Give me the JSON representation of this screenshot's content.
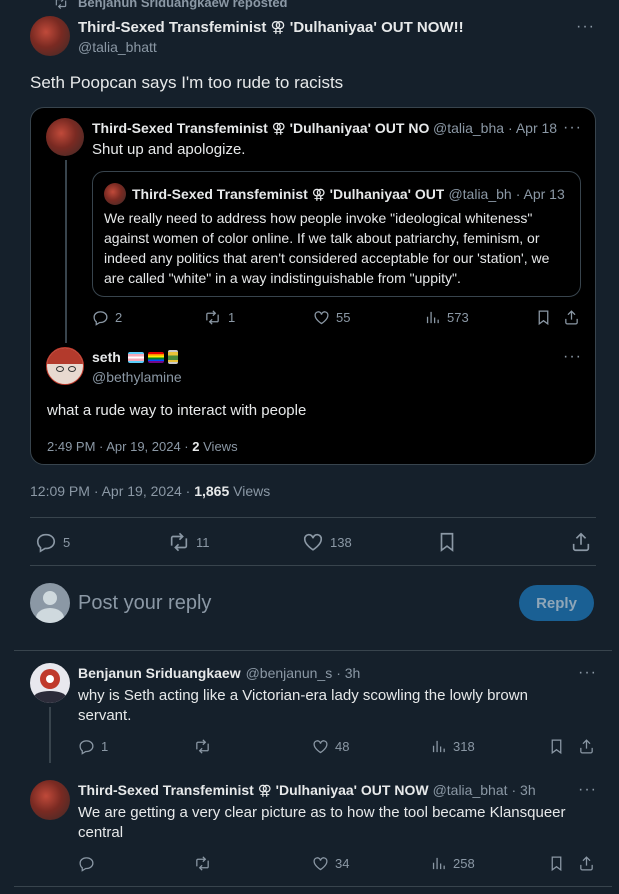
{
  "repost": {
    "text": "Benjanun Sriduangkaew reposted"
  },
  "main_post": {
    "author_name": "Third-Sexed Transfeminist ⚢ 'Dulhaniyaa' OUT NOW!!",
    "author_handle": "@talia_bhatt",
    "text": "Seth Poopcan says I'm too rude to racists",
    "time": "12:09 PM · Apr 19, 2024 ·",
    "views_count": "1,865",
    "views_label": "Views",
    "replies": "5",
    "reposts": "11",
    "likes": "138"
  },
  "quoted_thread": {
    "post1": {
      "author_name": "Third-Sexed Transfeminist ⚢ 'Dulhaniyaa' OUT NO",
      "author_handle": "@talia_bha",
      "date": "· Apr 18",
      "text": "Shut up and apologize.",
      "replies": "2",
      "reposts": "1",
      "likes": "55",
      "views": "573"
    },
    "nested_quote": {
      "author_name": "Third-Sexed Transfeminist ⚢ 'Dulhaniyaa' OUT",
      "author_handle": "@talia_bh",
      "date": "· Apr 13",
      "text": "We really need to address how people invoke \"ideological whiteness\" against women of color online. If we talk about patriarchy, feminism, or indeed any politics that aren't considered acceptable for our 'station', we are called \"white\" in a way indistinguishable from \"uppity\"."
    },
    "post2": {
      "author_name": "seth",
      "author_handle": "@bethylamine",
      "text": "what a rude way to interact with people",
      "time": "2:49 PM · Apr 19, 2024 ·",
      "views_count": "2",
      "views_label": "Views"
    }
  },
  "composer": {
    "placeholder": "Post your reply",
    "button": "Reply"
  },
  "replies": [
    {
      "author_name": "Benjanun Sriduangkaew",
      "author_handle": "@benjanun_s",
      "date": "· 3h",
      "text": "why is Seth acting like a Victorian-era lady scowling the lowly brown servant.",
      "replies": "1",
      "reposts": "",
      "likes": "48",
      "views": "318"
    },
    {
      "author_name": "Third-Sexed Transfeminist ⚢ 'Dulhaniyaa' OUT NOW",
      "author_handle": "@talia_bhat",
      "date": "· 3h",
      "text": "We are getting a very clear picture as to how the tool became Klansqueer central",
      "replies": "",
      "reposts": "",
      "likes": "34",
      "views": "258"
    }
  ],
  "icons": {
    "repost": "repost-icon",
    "reply": "reply-icon",
    "like": "heart-icon",
    "views": "bar-chart-icon",
    "bookmark": "bookmark-icon",
    "share": "share-icon",
    "more": "more-icon"
  },
  "colors": {
    "background": "#15202b",
    "quote_bg": "#000000",
    "border": "#38444d",
    "muted": "#8b98a5",
    "accent": "#1d9bf0",
    "reply_button": "#1a6094"
  }
}
